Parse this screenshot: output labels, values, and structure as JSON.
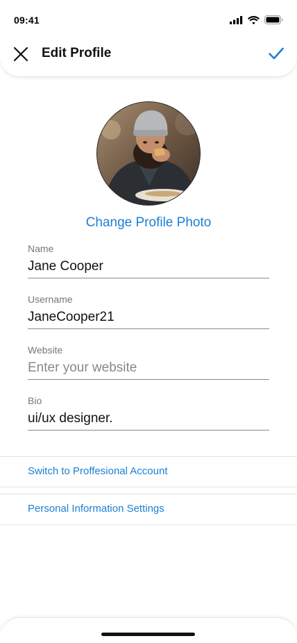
{
  "status_bar": {
    "time": "09:41",
    "icons": [
      "signal-icon",
      "wifi-icon",
      "battery-icon"
    ]
  },
  "header": {
    "title": "Edit Profile",
    "close_icon": "close-icon",
    "done_icon": "checkmark-icon"
  },
  "profile": {
    "change_photo_label": "Change Profile Photo"
  },
  "form": {
    "name": {
      "label": "Name",
      "value": "Jane Cooper",
      "placeholder": ""
    },
    "username": {
      "label": "Username",
      "value": "JaneCooper21",
      "placeholder": ""
    },
    "website": {
      "label": "Website",
      "value": "",
      "placeholder": "Enter your website"
    },
    "bio": {
      "label": "Bio",
      "value": "ui/ux designer.",
      "placeholder": ""
    }
  },
  "links": {
    "professional": "Switch to Proffesional Account",
    "personal_info": "Personal Information Settings"
  },
  "colors": {
    "accent": "#1a7fd4",
    "text": "#111111",
    "label": "#777777",
    "divider": "#e4e4e4"
  }
}
